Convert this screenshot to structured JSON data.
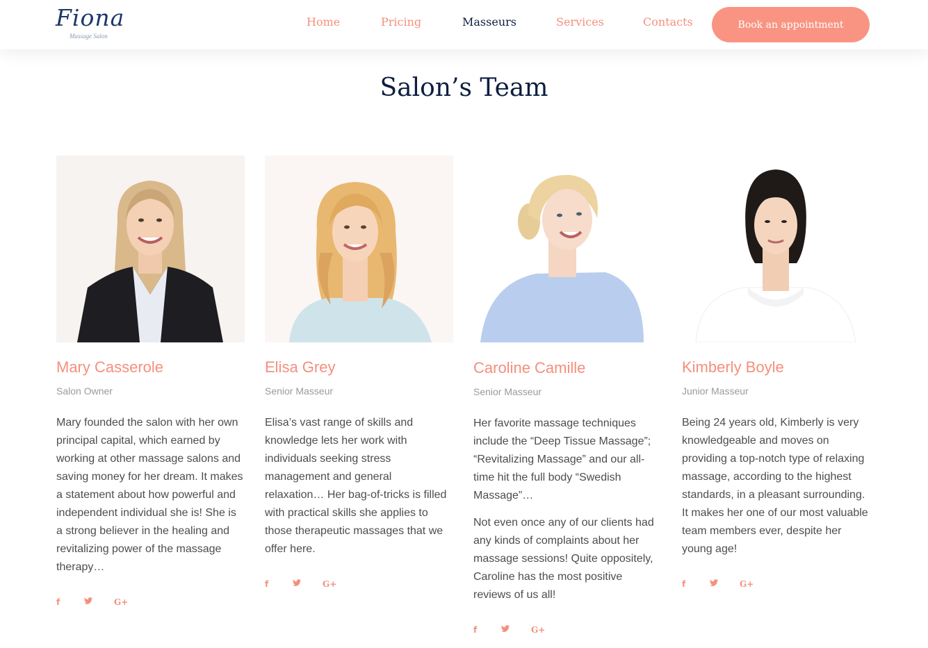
{
  "brand": {
    "name": "Fiona",
    "tagline": "Massage Salon",
    "colors": {
      "accent": "#f99482",
      "navy": "#0d1e3f",
      "text": "#4d4d4d",
      "muted": "#9a9a9a"
    }
  },
  "nav": {
    "items": [
      {
        "label": "Home",
        "active": false
      },
      {
        "label": "Pricing",
        "active": false
      },
      {
        "label": "Masseurs",
        "active": true
      },
      {
        "label": "Services",
        "active": false
      },
      {
        "label": "Contacts",
        "active": false
      }
    ],
    "cta_label": "Book an appointment"
  },
  "page": {
    "title": "Salon’s Team"
  },
  "team": [
    {
      "name": "Mary Casserole",
      "role": "Salon Owner",
      "bio": [
        "Mary founded the salon with her own principal capital, which earned by working at other massage salons and saving money for her dream. It makes a statement about how powerful and independent individual she is! She is a strong believer in the healing and revitalizing power of the massage therapy…"
      ],
      "social": {
        "facebook": "f",
        "twitter": "🐦",
        "google": "G+"
      }
    },
    {
      "name": "Elisa Grey",
      "role": "Senior Masseur",
      "bio": [
        "Elisa’s vast range of skills and knowledge lets her work with individuals seeking stress management and general relaxation… Her bag-of-tricks is filled with practical skills she applies to those therapeutic massages that we offer here."
      ],
      "social": {
        "facebook": "f",
        "twitter": "🐦",
        "google": "G+"
      }
    },
    {
      "name": "Caroline Camille",
      "role": "Senior Masseur",
      "bio": [
        "Her favorite massage techniques include the “Deep Tissue Massage”; “Revitalizing Massage” and our all-time hit the full body “Swedish Massage”…",
        "Not even once any of our clients had any kinds of complaints about her massage sessions! Quite oppositely, Caroline has the most positive reviews of us all!"
      ],
      "social": {
        "facebook": "f",
        "twitter": "🐦",
        "google": "G+"
      }
    },
    {
      "name": "Kimberly Boyle",
      "role": "Junior Masseur",
      "bio": [
        "Being 24 years old, Kimberly is very knowledgeable and moves on providing a top-notch type of relaxing massage, according to the highest standards, in a pleasant surrounding. It makes her one of our most valuable team members ever, despite her young age!"
      ],
      "social": {
        "facebook": "f",
        "twitter": "🐦",
        "google": "G+"
      }
    }
  ]
}
